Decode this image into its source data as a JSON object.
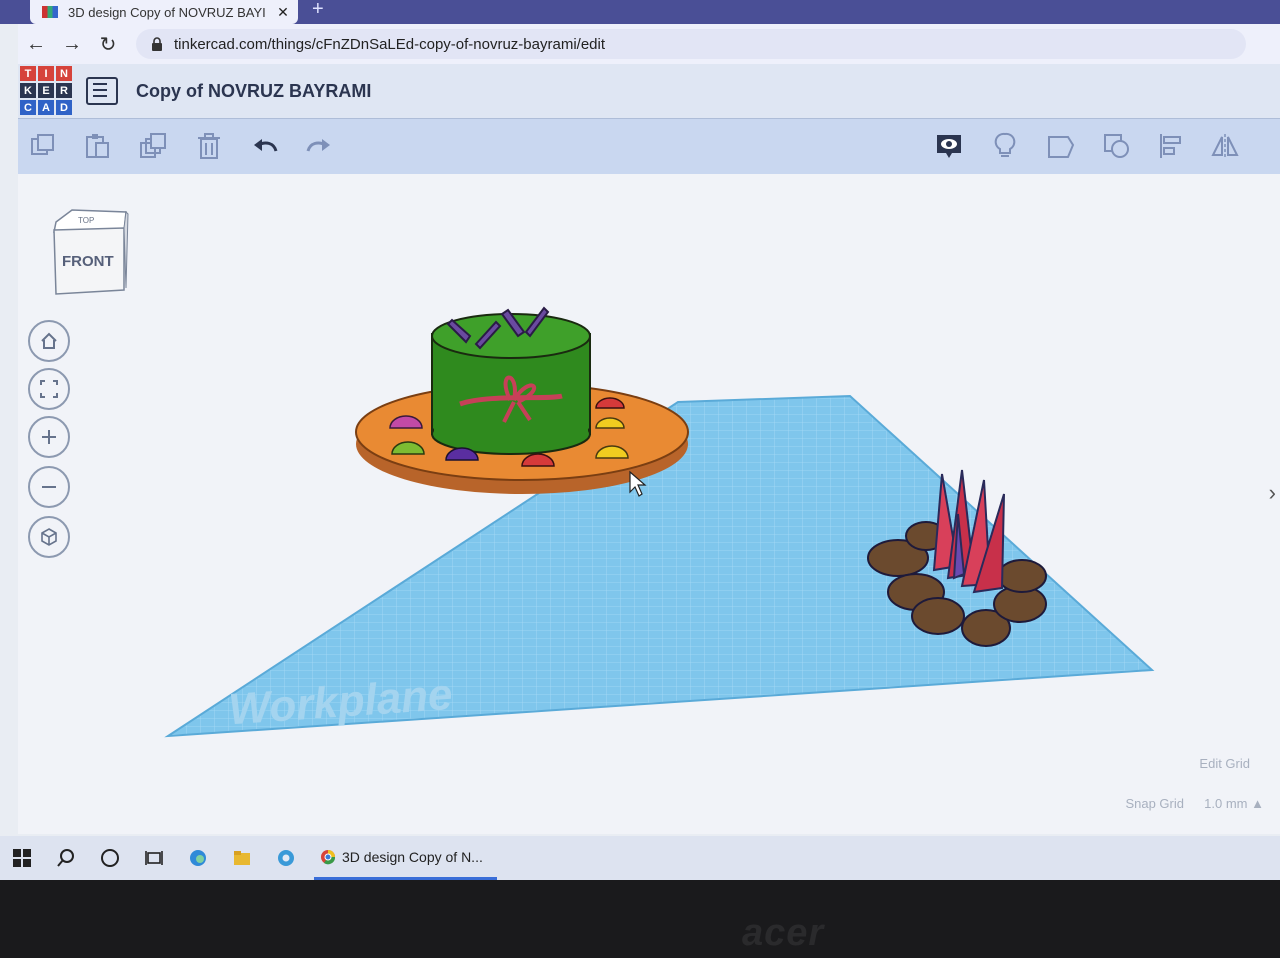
{
  "browser": {
    "tab_title": "3D design Copy of NOVRUZ BAYI",
    "tab_close": "✕",
    "new_tab": "+",
    "url": "tinkercad.com/things/cFnZDnSaLEd-copy-of-novruz-bayrami/edit"
  },
  "app": {
    "logo_letters": [
      "T",
      "I",
      "N",
      "K",
      "E",
      "R",
      "C",
      "A",
      "D"
    ],
    "design_title": "Copy of NOVRUZ BAYRAMI"
  },
  "toolbar": {
    "tools": [
      "copy-icon",
      "paste-icon",
      "duplicate-icon",
      "delete-icon",
      "undo-icon",
      "redo-icon",
      "show-all-icon",
      "notes-icon",
      "solid-icon",
      "hole-icon",
      "align-icon",
      "mirror-icon"
    ]
  },
  "viewport": {
    "viewcube_top": "TOP",
    "viewcube_front": "FRONT",
    "workplane_label": "Workplane",
    "edit_grid": "Edit Grid",
    "snap_grid": "Snap Grid",
    "snap_value": "1.0 mm ▲"
  },
  "taskbar": {
    "app_label": "3D design Copy of N..."
  },
  "bezel": {
    "brand": "acer"
  },
  "colors": {
    "accent": "#3a6ed8",
    "workplane": "#7fc6ec",
    "cake": "#2f8a1e",
    "plate": "#e98a33",
    "fire_logs": "#6b4a2e"
  }
}
